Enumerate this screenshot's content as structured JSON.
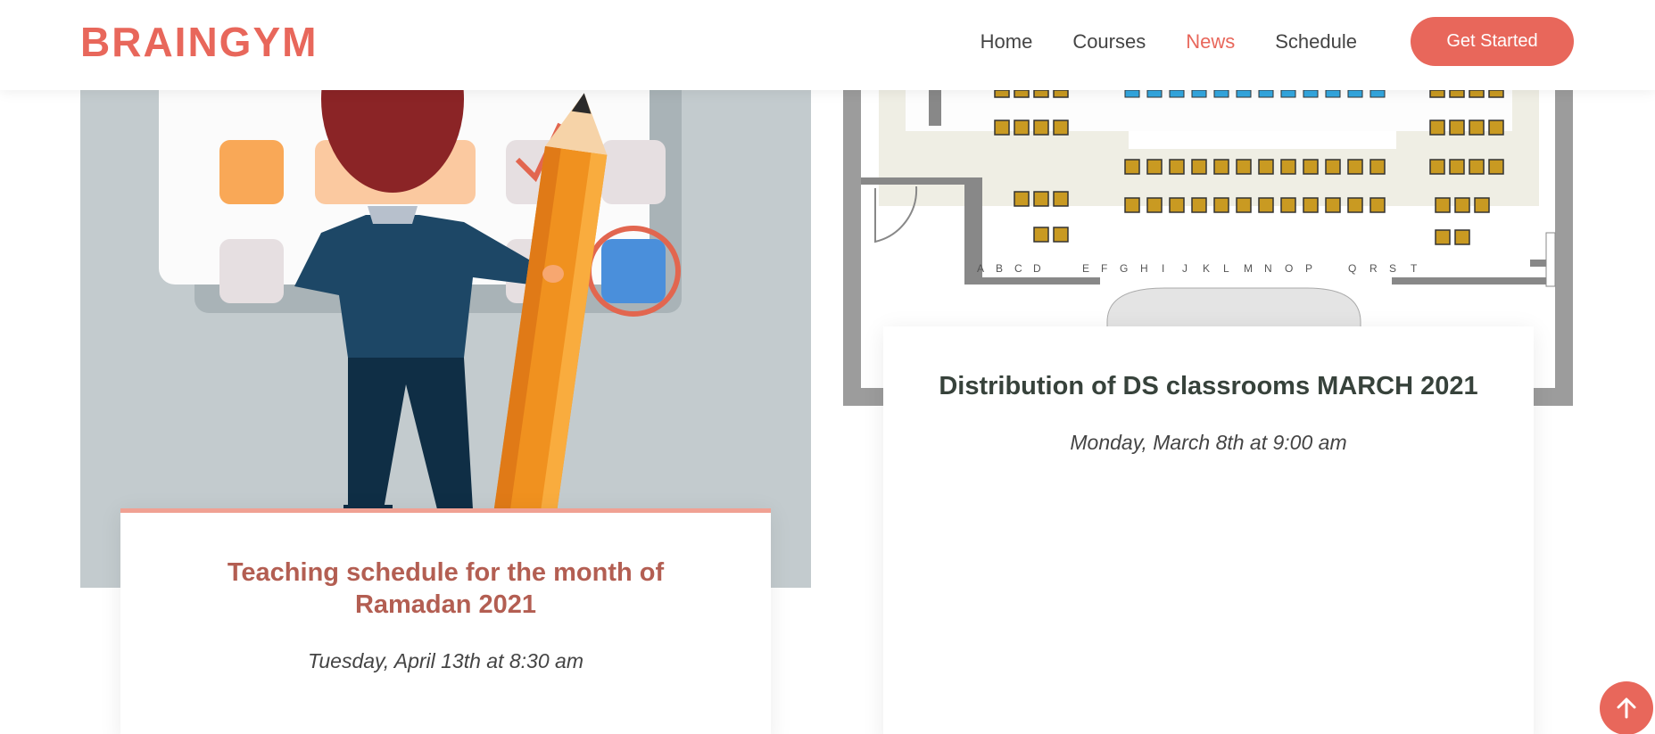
{
  "brand": {
    "logo": "BRAINGYM"
  },
  "nav": {
    "items": [
      {
        "label": "Home"
      },
      {
        "label": "Courses"
      },
      {
        "label": "News"
      },
      {
        "label": "Schedule"
      }
    ],
    "active": "News",
    "cta_label": "Get Started"
  },
  "news": [
    {
      "title": "Teaching schedule for the month of Ramadan 2021",
      "date": "Tuesday, April 13th at 8:30 am"
    },
    {
      "title": "Distribution of DS classrooms MARCH 2021",
      "date": "Monday, March 8th at 9:00 am"
    }
  ],
  "seat_letters": [
    "A",
    "B",
    "C",
    "D",
    "E",
    "F",
    "G",
    "H",
    "I",
    "J",
    "K",
    "L",
    "M",
    "N",
    "O",
    "P",
    "Q",
    "R",
    "S",
    "T"
  ],
  "icons": {
    "scroll_top": "arrow-up-icon"
  },
  "colors": {
    "accent": "#e8675b",
    "title_card1": "#b35e52",
    "title_card2": "#37423b"
  }
}
